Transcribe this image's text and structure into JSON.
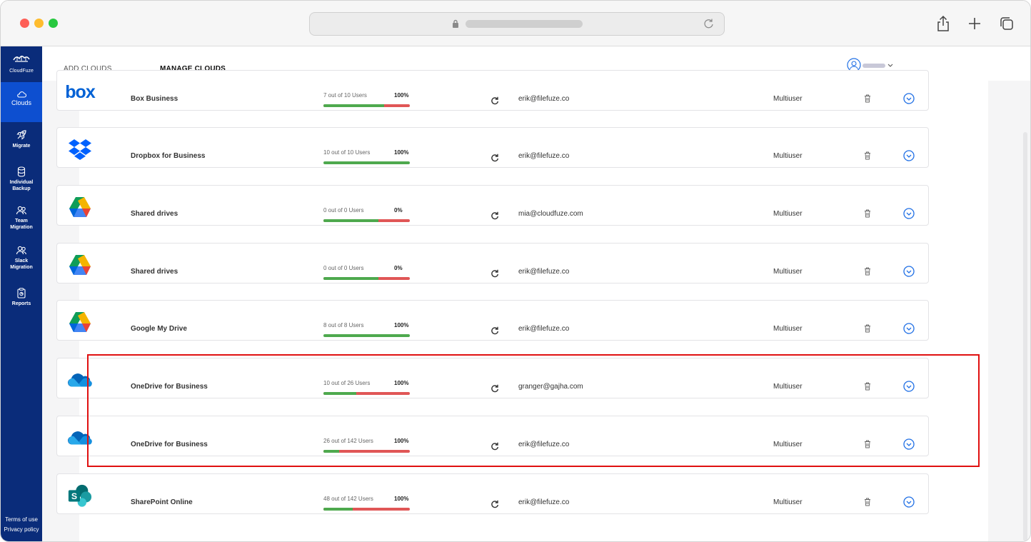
{
  "sidebar": {
    "logo_text": "CloudFuze",
    "items": [
      {
        "label": "Clouds",
        "icon": "cloud-icon",
        "active": true
      },
      {
        "label": "Migrate",
        "icon": "rocket-icon"
      },
      {
        "label": "Individual Backup",
        "icon": "database-icon"
      },
      {
        "label": "Team Migration",
        "icon": "team-icon"
      },
      {
        "label": "Slack Migration",
        "icon": "team-icon"
      },
      {
        "label": "Reports",
        "icon": "report-icon"
      }
    ],
    "footer": {
      "terms": "Terms of use",
      "privacy": "Privacy policy"
    }
  },
  "tabs": {
    "add": "ADD CLOUDS",
    "manage": "MANAGE CLOUDS"
  },
  "colors": {
    "sidebar": "#0a2c7a",
    "active_nav": "#0d4fd0",
    "tab_underline": "#58b9c7",
    "bar_used": "#4ea94e",
    "bar_rest": "#e05656",
    "highlight": "#e01010",
    "accent_icon": "#1f6fe5"
  },
  "clouds": [
    {
      "name": "Box Business",
      "logo": "box-logo",
      "users": "7 out of 10 Users",
      "percent": "100%",
      "used_fraction": 0.7,
      "email": "erik@filefuze.co",
      "type": "Multiuser"
    },
    {
      "name": "Dropbox for Business",
      "logo": "dropbox-logo",
      "users": "10 out of 10 Users",
      "percent": "100%",
      "used_fraction": 1.0,
      "email": "erik@filefuze.co",
      "type": "Multiuser"
    },
    {
      "name": "Shared drives",
      "logo": "google-drive-logo",
      "users": "0 out of 0 Users",
      "percent": "0%",
      "used_fraction": 0.64,
      "email": "mia@cloudfuze.com",
      "type": "Multiuser"
    },
    {
      "name": "Shared drives",
      "logo": "google-drive-logo",
      "users": "0 out of 0 Users",
      "percent": "0%",
      "used_fraction": 0.64,
      "email": "erik@filefuze.co",
      "type": "Multiuser"
    },
    {
      "name": "Google My Drive",
      "logo": "google-drive-logo",
      "users": "8 out of 8 Users",
      "percent": "100%",
      "used_fraction": 1.0,
      "email": "erik@filefuze.co",
      "type": "Multiuser"
    },
    {
      "name": "OneDrive for Business",
      "logo": "onedrive-logo",
      "users": "10 out of 26 Users",
      "percent": "100%",
      "used_fraction": 0.38,
      "email": "granger@gajha.com",
      "type": "Multiuser"
    },
    {
      "name": "OneDrive for Business",
      "logo": "onedrive-logo",
      "users": "26 out of 142 Users",
      "percent": "100%",
      "used_fraction": 0.18,
      "email": "erik@filefuze.co",
      "type": "Multiuser"
    },
    {
      "name": "SharePoint Online",
      "logo": "sharepoint-logo",
      "users": "48 out of 142 Users",
      "percent": "100%",
      "used_fraction": 0.34,
      "email": "erik@filefuze.co",
      "type": "Multiuser"
    }
  ]
}
